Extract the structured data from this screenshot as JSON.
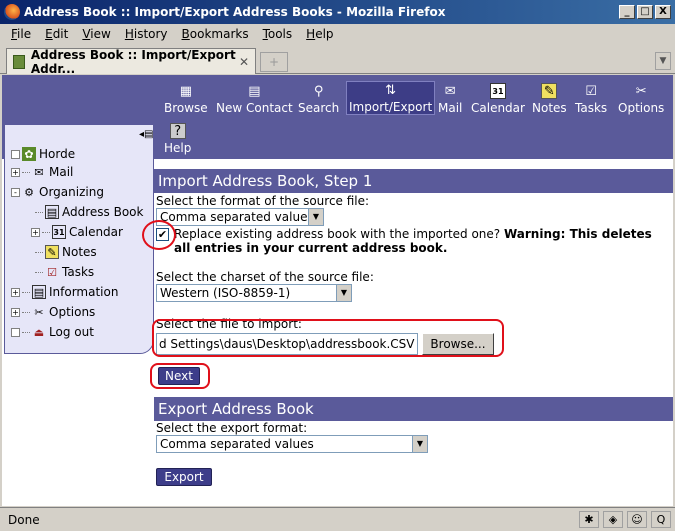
{
  "window": {
    "title": "Address Book :: Import/Export Address Books - Mozilla Firefox",
    "controls": [
      "_",
      "□",
      "X"
    ]
  },
  "menubar": [
    "File",
    "Edit",
    "View",
    "History",
    "Bookmarks",
    "Tools",
    "Help"
  ],
  "tab": {
    "label": "Address Book :: Import/Export Addr...",
    "close": "✕",
    "newtab": "+"
  },
  "topnav": {
    "items": [
      {
        "label": "Browse",
        "icon": "browse-icon"
      },
      {
        "label": "New Contact",
        "icon": "new-contact-icon"
      },
      {
        "label": "Search",
        "icon": "search-icon"
      },
      {
        "label": "Import/Export",
        "icon": "import-export-icon",
        "active": true
      },
      {
        "label": "Mail",
        "icon": "mail-icon"
      },
      {
        "label": "Calendar",
        "icon": "calendar-icon",
        "glyph": "31"
      },
      {
        "label": "Notes",
        "icon": "notes-icon"
      },
      {
        "label": "Tasks",
        "icon": "tasks-icon"
      },
      {
        "label": "Options",
        "icon": "options-icon"
      },
      {
        "label": "Help",
        "icon": "help-icon"
      }
    ]
  },
  "sidebar": {
    "items": [
      {
        "label": "Horde",
        "toggle": "",
        "icon": "horde-icon"
      },
      {
        "label": "Mail",
        "toggle": "+",
        "icon": "mail-icon"
      },
      {
        "label": "Organizing",
        "toggle": "-",
        "icon": "organizing-icon"
      },
      {
        "label": "Address Book",
        "toggle": "",
        "icon": "address-book-icon"
      },
      {
        "label": "Calendar",
        "toggle": "+",
        "icon": "calendar-icon",
        "glyph": "31"
      },
      {
        "label": "Notes",
        "toggle": "",
        "icon": "notes-icon"
      },
      {
        "label": "Tasks",
        "toggle": "",
        "icon": "tasks-icon"
      },
      {
        "label": "Information",
        "toggle": "+",
        "icon": "information-icon"
      },
      {
        "label": "Options",
        "toggle": "+",
        "icon": "options-icon"
      },
      {
        "label": "Log out",
        "toggle": "",
        "icon": "logout-icon"
      }
    ]
  },
  "import": {
    "heading": "Import Address Book, Step 1",
    "format_label": "Select the format of the source file:",
    "format_value": "Comma separated values",
    "replace_checked": true,
    "replace_text": "Replace existing address book with the imported one?",
    "replace_warning": "Warning: This deletes all entries in your current address book.",
    "charset_label": "Select the charset of the source file:",
    "charset_value": "Western (ISO-8859-1)",
    "file_label": "Select the file to import:",
    "file_value": "d Settings\\daus\\Desktop\\addressbook.CSV",
    "browse_label": "Browse...",
    "next_label": "Next"
  },
  "export": {
    "heading": "Export Address Book",
    "format_label": "Select the export format:",
    "format_value": "Comma separated values",
    "export_label": "Export"
  },
  "status": {
    "text": "Done"
  }
}
